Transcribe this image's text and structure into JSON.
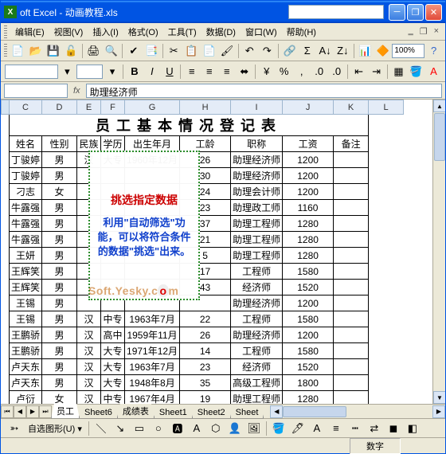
{
  "window": {
    "app": "oft Excel",
    "file": "动画教程.xls"
  },
  "menus": [
    "编辑(E)",
    "视图(V)",
    "插入(I)",
    "格式(O)",
    "工具(T)",
    "数据(D)",
    "窗口(W)",
    "帮助(H)"
  ],
  "zoom": "100%",
  "formula": {
    "cell": "",
    "value": "助理经济师",
    "fx": "fx"
  },
  "columns": [
    "C",
    "D",
    "E",
    "F",
    "G",
    "H",
    "I",
    "J",
    "K",
    "L"
  ],
  "title": "员工基本情况登记表",
  "headers": [
    "姓名",
    "性别",
    "民族",
    "学历",
    "出生年月",
    "工龄",
    "职称",
    "工资",
    "备注"
  ],
  "rows": [
    [
      "丁骏婷",
      "男",
      "汉",
      "大专",
      "1960年12月",
      "26",
      "助理经济师",
      "1200",
      ""
    ],
    [
      "丁骏婷",
      "男",
      "",
      "",
      "",
      "30",
      "助理经济师",
      "1200",
      ""
    ],
    [
      "刁志",
      "女",
      "",
      "",
      "",
      "24",
      "助理会计师",
      "1200",
      ""
    ],
    [
      "牛露强",
      "男",
      "",
      "",
      "",
      "23",
      "助理政工师",
      "1160",
      ""
    ],
    [
      "牛露强",
      "男",
      "",
      "",
      "",
      "37",
      "助理工程师",
      "1280",
      ""
    ],
    [
      "牛露强",
      "男",
      "",
      "",
      "",
      "21",
      "助理工程师",
      "1280",
      ""
    ],
    [
      "王妍",
      "男",
      "",
      "",
      "",
      "5",
      "助理工程师",
      "1280",
      ""
    ],
    [
      "王辉笑",
      "男",
      "",
      "",
      "",
      "17",
      "工程师",
      "1580",
      ""
    ],
    [
      "王辉笑",
      "男",
      "",
      "",
      "",
      "43",
      "经济师",
      "1520",
      ""
    ],
    [
      "王锡",
      "男",
      "",
      "",
      "",
      "",
      "助理经济师",
      "1200",
      ""
    ],
    [
      "王锡",
      "男",
      "汉",
      "中专",
      "1963年7月",
      "22",
      "工程师",
      "1580",
      ""
    ],
    [
      "王鹏骄",
      "男",
      "汉",
      "高中",
      "1959年11月",
      "26",
      "助理经济师",
      "1200",
      ""
    ],
    [
      "王鹏骄",
      "男",
      "汉",
      "大专",
      "1971年12月",
      "14",
      "工程师",
      "1580",
      ""
    ],
    [
      "卢天东",
      "男",
      "汉",
      "大专",
      "1963年7月",
      "23",
      "经济师",
      "1520",
      ""
    ],
    [
      "卢天东",
      "男",
      "汉",
      "大专",
      "1948年8月",
      "35",
      "高级工程师",
      "1800",
      ""
    ],
    [
      "卢衍",
      "女",
      "汉",
      "中专",
      "1967年4月",
      "19",
      "助理工程师",
      "1280",
      ""
    ]
  ],
  "overlay": {
    "t1": "挑选指定数据",
    "t2": "利用\"自动筛选\"功能，可以将符合条件的数据\"挑选\"出来。"
  },
  "watermark": "Soft.Yesky.c",
  "watermark_red": "o",
  "watermark_end": "m",
  "tabs": [
    "员工",
    "Sheet6",
    "成绩表",
    "Sheet1",
    "Sheet2",
    "Sheet"
  ],
  "active_tab": 0,
  "formatbar": {
    "bold": "B",
    "italic": "I",
    "underline": "U"
  },
  "drawbar": {
    "label": "自选图形(U)"
  },
  "status": {
    "right": "数字"
  }
}
